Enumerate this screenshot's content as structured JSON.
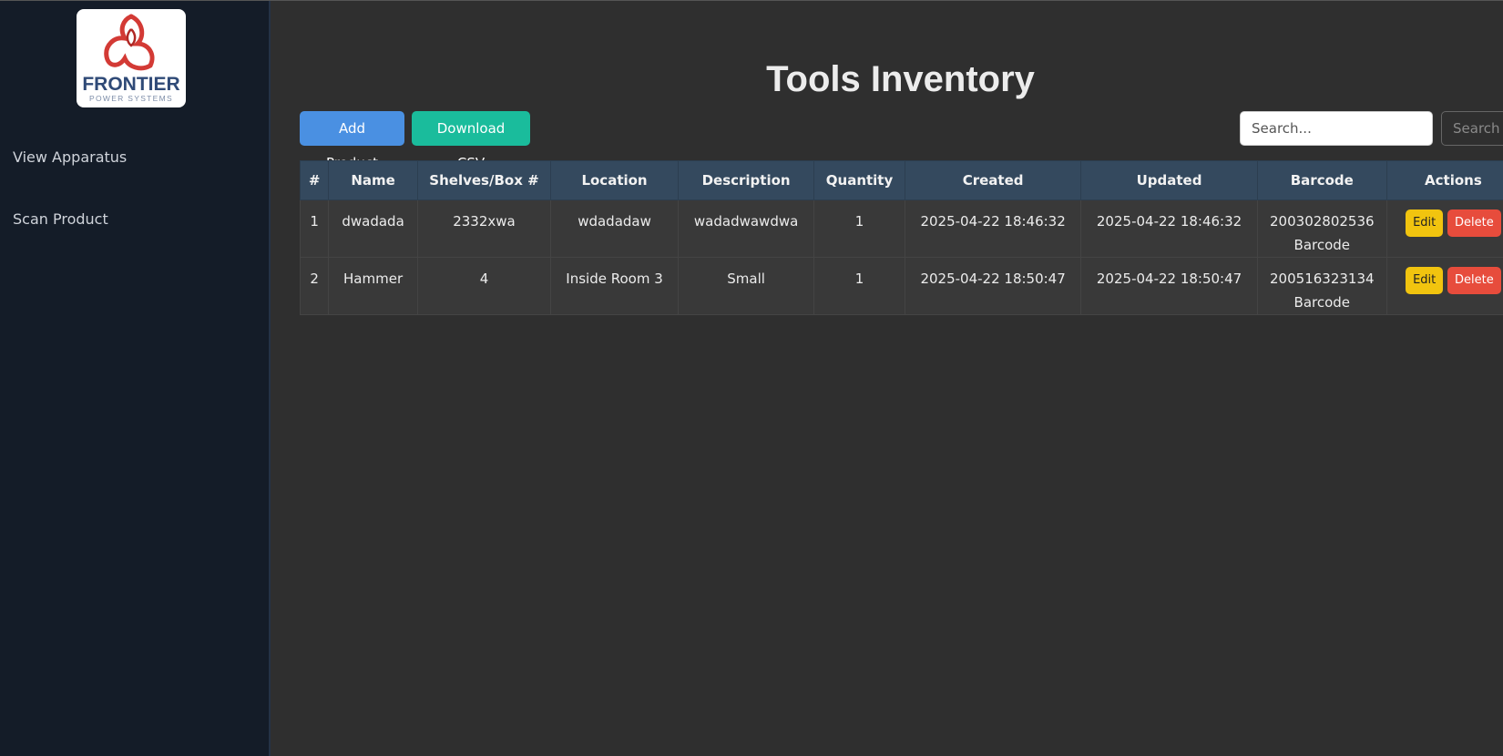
{
  "sidebar": {
    "logo": {
      "word": "FRONTIER",
      "sub": "POWER SYSTEMS"
    },
    "items": [
      {
        "label": "View Apparatus"
      },
      {
        "label": "Scan Product"
      }
    ]
  },
  "main": {
    "title": "Tools Inventory",
    "add_label": "Add Product",
    "csv_label": "Download CSV",
    "search_placeholder": "Search...",
    "search_button": "Search"
  },
  "table": {
    "headers": [
      "#",
      "Name",
      "Shelves/Box #",
      "Location",
      "Description",
      "Quantity",
      "Created",
      "Updated",
      "Barcode",
      "Actions"
    ],
    "rows": [
      {
        "num": "1",
        "name": "dwadada",
        "shelf": "2332xwa",
        "location": "wdadadaw",
        "description": "wadadwawdwa",
        "quantity": "1",
        "created": "2025-04-22 18:46:32",
        "updated": "2025-04-22 18:46:32",
        "barcode": "200302802536",
        "barcode_label": "Barcode",
        "edit": "Edit",
        "delete": "Delete"
      },
      {
        "num": "2",
        "name": "Hammer",
        "shelf": "4",
        "location": "Inside Room 3",
        "description": "Small",
        "quantity": "1",
        "created": "2025-04-22 18:50:47",
        "updated": "2025-04-22 18:50:47",
        "barcode": "200516323134",
        "barcode_label": "Barcode",
        "edit": "Edit",
        "delete": "Delete"
      }
    ]
  },
  "colors": {
    "sidebar_bg": "#141c28",
    "main_bg": "#2f2f2f",
    "header_bg": "#34495e",
    "add_button": "#4a90e2",
    "csv_button": "#1abc9c",
    "edit_button": "#f1c40f",
    "delete_button": "#e74c3c"
  }
}
